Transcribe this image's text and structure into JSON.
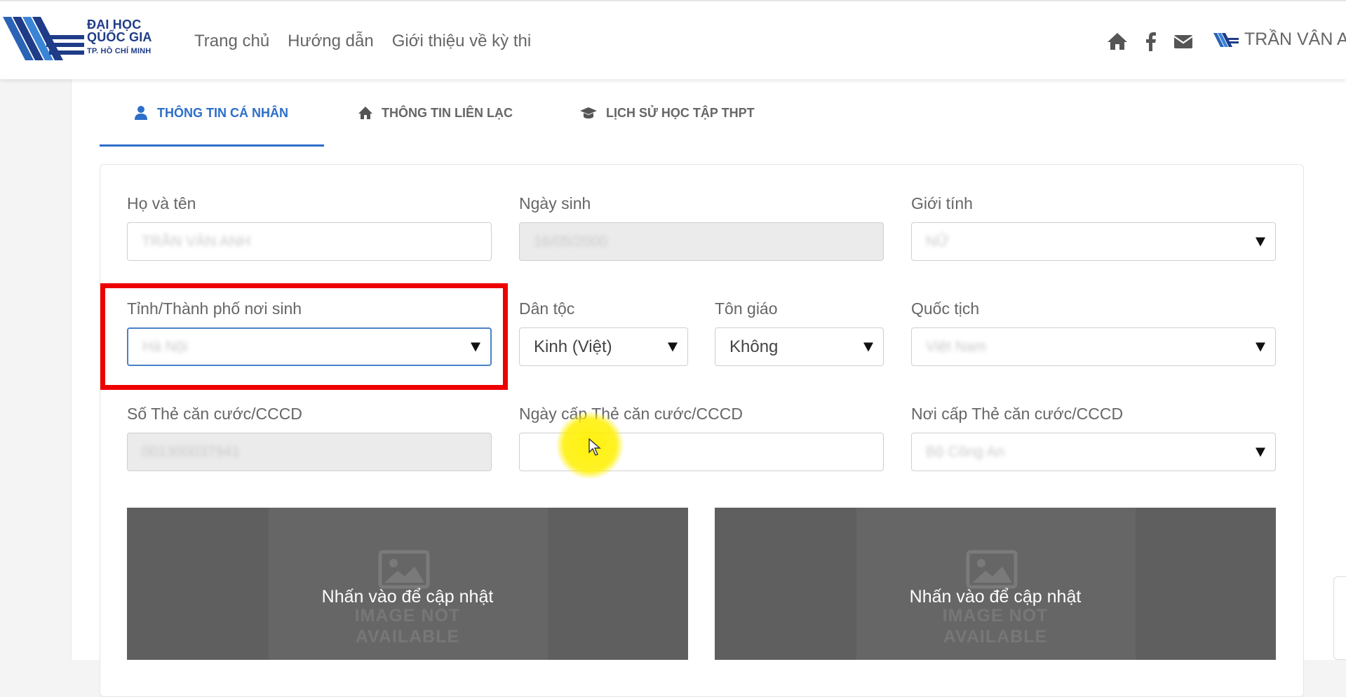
{
  "logo": {
    "line1": "ĐẠI HỌC",
    "line2": "QUỐC GIA",
    "line3": "TP. HỒ CHÍ MINH"
  },
  "nav": {
    "home": "Trang chủ",
    "guide": "Hướng dẫn",
    "about": "Giới thiệu về kỳ thi"
  },
  "header_icons": [
    "home-icon",
    "facebook-icon",
    "mail-icon"
  ],
  "user": {
    "name": "TRẦN VÂN A"
  },
  "tabs": [
    {
      "label": "THÔNG TIN CÁ NHÂN",
      "icon": "user-icon",
      "active": true
    },
    {
      "label": "THÔNG TIN LIÊN LẠC",
      "icon": "home-icon",
      "active": false
    },
    {
      "label": "LỊCH SỬ HỌC TẬP THPT",
      "icon": "graduation-cap-icon",
      "active": false
    }
  ],
  "form": {
    "full_name": {
      "label": "Họ và tên",
      "value": "TRẦN VÂN ANH"
    },
    "dob": {
      "label": "Ngày sinh",
      "value": "16/05/2000"
    },
    "gender": {
      "label": "Giới tính",
      "value": "NỮ"
    },
    "birthplace": {
      "label": "Tỉnh/Thành phố nơi sinh",
      "value": "Hà Nội"
    },
    "ethnicity": {
      "label": "Dân tộc",
      "value": "Kinh (Việt)"
    },
    "religion": {
      "label": "Tôn giáo",
      "value": "Không"
    },
    "nationality": {
      "label": "Quốc tịch",
      "value": "Việt Nam"
    },
    "id_number": {
      "label": "Số Thẻ căn cước/CCCD",
      "value": "001300037941"
    },
    "id_issue_date": {
      "label": "Ngày cấp Thẻ căn cước/CCCD",
      "value": ""
    },
    "id_issue_place": {
      "label": "Nơi cấp Thẻ căn cước/CCCD",
      "value": "Bộ Công An"
    }
  },
  "image_panels": [
    {
      "placeholder_line1": "IMAGE NOT",
      "placeholder_line2": "AVAILABLE",
      "cta": "Nhấn vào để cập nhật"
    },
    {
      "placeholder_line1": "IMAGE NOT",
      "placeholder_line2": "AVAILABLE",
      "cta": "Nhấn vào để cập nhật"
    }
  ],
  "colors": {
    "brand": "#1f3c88",
    "tab_active": "#2d6ec9",
    "highlight": "#ee0000",
    "cursor_highlight": "#fff000"
  }
}
